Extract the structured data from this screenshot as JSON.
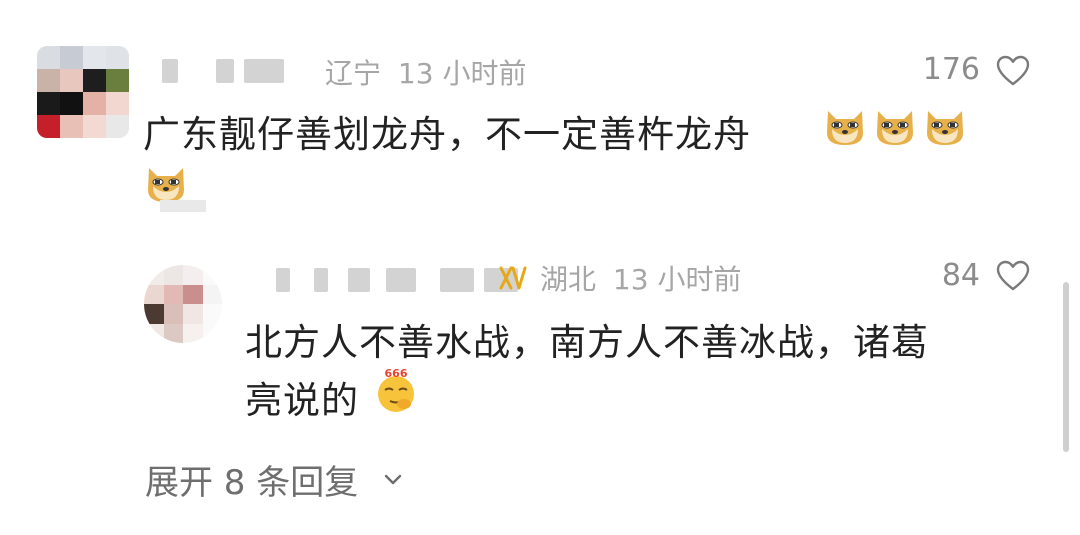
{
  "comments": [
    {
      "location": "辽宁",
      "time": "13 小时前",
      "likes": "176",
      "text": "广东靓仔善划龙舟，不一定善杵龙舟",
      "emoji": "doge"
    },
    {
      "location": "湖北",
      "time": "13 小时前",
      "likes": "84",
      "text_line1": "北方人不善水战，南方人不善冰战，诸葛",
      "text_line2": "亮说的",
      "emoji": "666",
      "badge_icon": "xv-badge-icon"
    }
  ],
  "expand_replies": "展开 8 条回复",
  "colors": {
    "meta": "#a6a6a6",
    "badge": "#e6a817",
    "text": "#222222"
  }
}
